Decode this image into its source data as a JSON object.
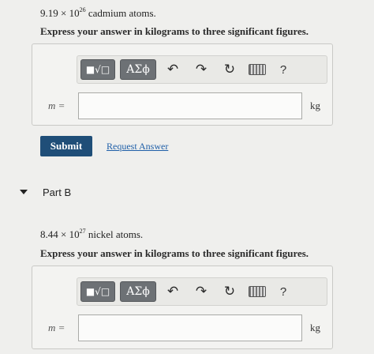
{
  "part_a": {
    "problem_coefficient": "9.19",
    "problem_times": "×",
    "problem_base": "10",
    "problem_exponent": "26",
    "problem_substance": "cadmium atoms.",
    "instruction": "Express your answer in kilograms to three significant figures.",
    "variable_label": "m =",
    "input_value": "",
    "unit": "kg",
    "submit_label": "Submit",
    "request_answer_label": "Request Answer"
  },
  "part_b": {
    "title": "Part B",
    "problem_coefficient": "8.44",
    "problem_times": "×",
    "problem_base": "10",
    "problem_exponent": "27",
    "problem_substance": "nickel atoms.",
    "instruction": "Express your answer in kilograms to three significant figures.",
    "variable_label": "m =",
    "input_value": "",
    "unit": "kg"
  },
  "toolbar": {
    "templates_glyph": "■√□",
    "greek_label": "ΑΣϕ",
    "undo_glyph": "↶",
    "redo_glyph": "↷",
    "reset_glyph": "↻",
    "help_label": "?"
  },
  "icons": {
    "templates": "templates-icon",
    "greek": "greek-symbols-icon",
    "undo": "undo-icon",
    "redo": "redo-icon",
    "reset": "reset-icon",
    "keyboard": "keyboard-icon",
    "help": "help-icon",
    "collapse": "caret-down-icon"
  },
  "colors": {
    "submit_bg": "#1f4e78",
    "link": "#1f5fa8",
    "toolbar_button": "#6d7175"
  }
}
